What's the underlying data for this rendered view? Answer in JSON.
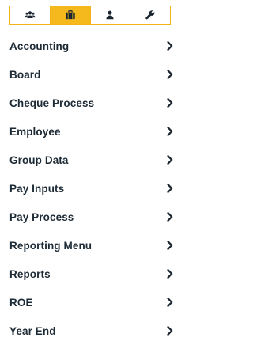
{
  "tabs": [
    {
      "icon": "users-icon",
      "active": false
    },
    {
      "icon": "briefcase-icon",
      "active": true
    },
    {
      "icon": "user-icon",
      "active": false
    },
    {
      "icon": "wrench-icon",
      "active": false
    }
  ],
  "menu": {
    "items": [
      {
        "label": "Accounting"
      },
      {
        "label": "Board"
      },
      {
        "label": "Cheque Process"
      },
      {
        "label": "Employee"
      },
      {
        "label": "Group Data"
      },
      {
        "label": "Pay Inputs"
      },
      {
        "label": "Pay Process"
      },
      {
        "label": "Reporting Menu"
      },
      {
        "label": "Reports"
      },
      {
        "label": "ROE"
      },
      {
        "label": "Year End"
      }
    ]
  },
  "colors": {
    "accent": "#f6b91d",
    "border": "#f3b21a",
    "text": "#1d2b36",
    "icon": "#1a2530"
  }
}
